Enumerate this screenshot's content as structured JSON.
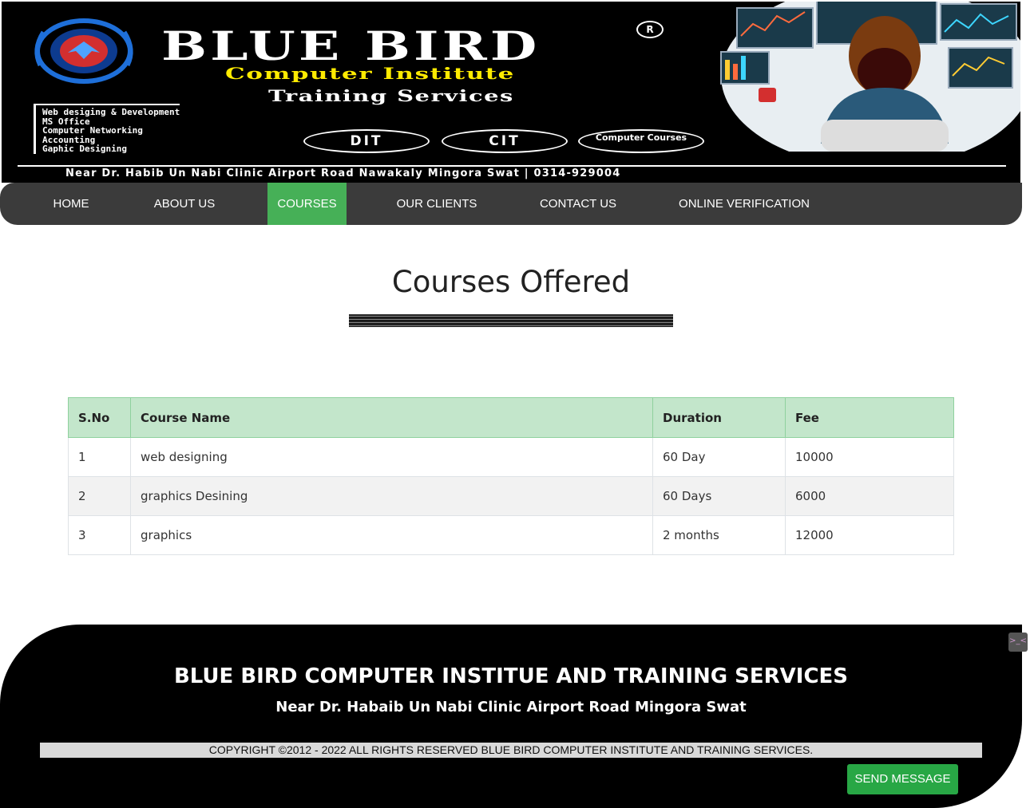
{
  "banner": {
    "title": "BLUE BIRD",
    "reg_mark": "R",
    "subtitle": "Computer Institute",
    "tagline": "Training Services",
    "services": [
      "Web desiging & Development",
      "MS Office",
      "Computer Networking",
      "Accounting",
      "Gaphic Designing"
    ],
    "programs": [
      "DIT",
      "CIT",
      "Computer Courses"
    ],
    "address": "Near Dr. Habib Un Nabi Clinic Airport Road Nawakaly Mingora Swat | 0314-929004"
  },
  "nav": {
    "items": [
      "HOME",
      "ABOUT US",
      "COURSES",
      "OUR CLIENTS",
      "CONTACT US",
      "ONLINE VERIFICATION"
    ],
    "active": "COURSES",
    "active_color": "#46b057",
    "bg_color": "#3b3b3b"
  },
  "main": {
    "heading": "Courses Offered"
  },
  "table": {
    "headers": [
      "S.No",
      "Course Name",
      "Duration",
      "Fee"
    ],
    "rows": [
      [
        "1",
        "web designing",
        "60 Day",
        "10000"
      ],
      [
        "2",
        "graphics Desining",
        "60 Days",
        "6000"
      ],
      [
        "3",
        "graphics",
        "2 months",
        "12000"
      ]
    ],
    "header_color": "#c3e6cb"
  },
  "footer": {
    "title": "BLUE BIRD COMPUTER INSTITUE AND TRAINING SERVICES",
    "address": "Near Dr. Habaib Un Nabi Clinic Airport Road Mingora Swat",
    "copyright": "COPYRIGHT ©2012 - 2022 ALL RIGHTS RESERVED BLUE BIRD COMPUTER INSTITUTE AND TRAINING SERVICES.",
    "send_button": "SEND MESSAGE",
    "button_color": "#28a745"
  },
  "side_widget": {
    "icon": "terminal-icon",
    "label": ">_<"
  }
}
